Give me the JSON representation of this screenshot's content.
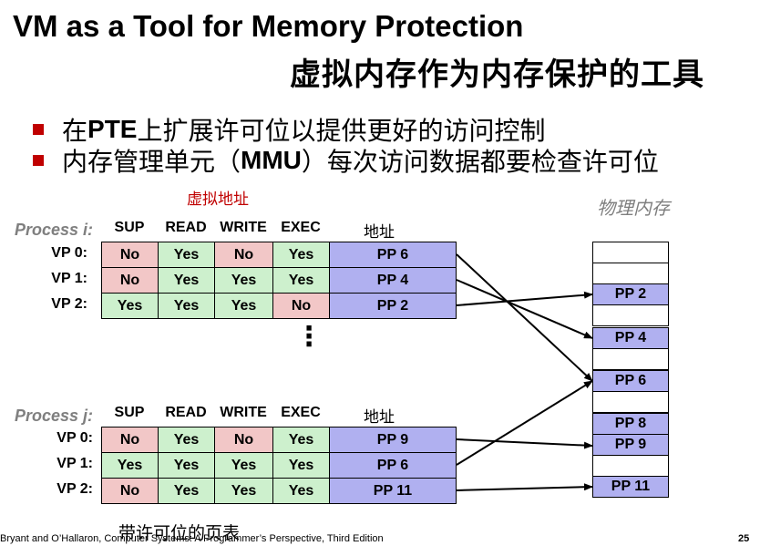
{
  "slide": {
    "title_en": "VM as a Tool for Memory Protection",
    "title_cn": "虚拟内存作为内存保护的工具",
    "bullets": [
      {
        "pre": "在 ",
        "bold": "PTE",
        "post": " 上扩展许可位以提供更好的访问控制"
      },
      {
        "pre": "内存管理单元（",
        "bold": "MMU",
        "post": "）每次访问数据都要检查许可位"
      }
    ],
    "virtual_address_note": "虚拟地址",
    "physical_memory_note": "物理内存",
    "page_table_caption": "带许可位的页表",
    "footer": "Bryant and O’Hallaron, Computer Systems: A Programmer’s Perspective, Third Edition",
    "page_number": "25",
    "ellipsis": "⋮"
  },
  "process_i": {
    "label": "Process i:",
    "headers": [
      "SUP",
      "READ",
      "WRITE",
      "EXEC",
      "地址"
    ],
    "rows": [
      {
        "vp": "VP 0:",
        "sup": "No",
        "read": "Yes",
        "write": "No",
        "exec": "Yes",
        "addr": "PP 6"
      },
      {
        "vp": "VP 1:",
        "sup": "No",
        "read": "Yes",
        "write": "Yes",
        "exec": "Yes",
        "addr": "PP 4"
      },
      {
        "vp": "VP 2:",
        "sup": "Yes",
        "read": "Yes",
        "write": "Yes",
        "exec": "No",
        "addr": "PP 2"
      }
    ]
  },
  "process_j": {
    "label": "Process j:",
    "headers": [
      "SUP",
      "READ",
      "WRITE",
      "EXEC",
      "地址"
    ],
    "rows": [
      {
        "vp": "VP 0:",
        "sup": "No",
        "read": "Yes",
        "write": "No",
        "exec": "Yes",
        "addr": "PP 9"
      },
      {
        "vp": "VP 1:",
        "sup": "Yes",
        "read": "Yes",
        "write": "Yes",
        "exec": "Yes",
        "addr": "PP 6"
      },
      {
        "vp": "VP 2:",
        "sup": "No",
        "read": "Yes",
        "write": "Yes",
        "exec": "Yes",
        "addr": "PP 11"
      }
    ]
  },
  "physical_memory": {
    "pages": [
      "PP 2",
      "PP 4",
      "PP 6",
      "PP 8",
      "PP 9",
      "PP 11"
    ]
  },
  "colors": {
    "no_cell": "#f2c7c7",
    "yes_cell": "#cdf0cd",
    "addr_cell": "#b0b0f0",
    "accent_red": "#c00000"
  }
}
